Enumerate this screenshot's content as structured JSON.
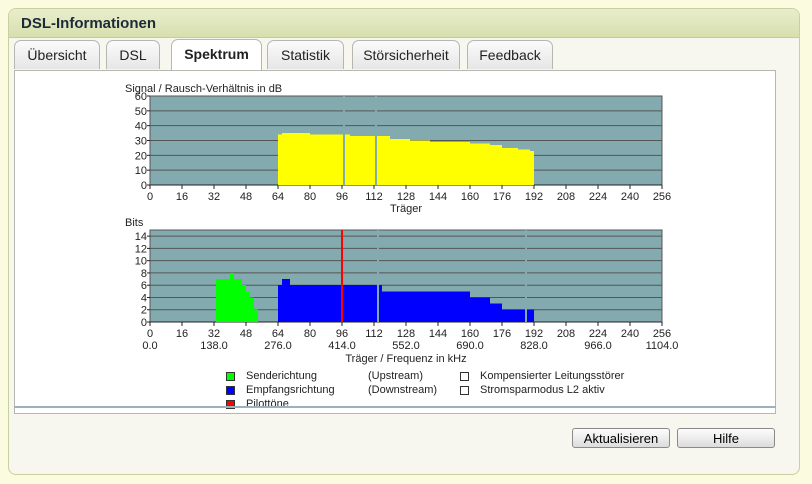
{
  "header": {
    "title": "DSL-Informationen"
  },
  "tabs": [
    {
      "label": "Übersicht"
    },
    {
      "label": "DSL"
    },
    {
      "label": "Spektrum",
      "active": true
    },
    {
      "label": "Statistik"
    },
    {
      "label": "Störsicherheit"
    },
    {
      "label": "Feedback"
    }
  ],
  "colors": {
    "plot_bg": "#83abaf",
    "snr": "#ffff00",
    "upstream": "#00ff00",
    "downstream": "#0000ff",
    "pilot": "#ff0000"
  },
  "chart_data": [
    {
      "type": "bar",
      "title": "Signal / Rausch-Verhältnis in dB",
      "xlabel": "Träger",
      "ylabel": "Signal / Rausch-Verhältnis in dB",
      "xlim": [
        0,
        256
      ],
      "ylim": [
        0,
        60
      ],
      "xticks": [
        "0",
        "16",
        "32",
        "48",
        "64",
        "80",
        "96",
        "112",
        "128",
        "144",
        "160",
        "176",
        "192",
        "208",
        "224",
        "240",
        "256"
      ],
      "yticks": [
        "0",
        "10",
        "20",
        "30",
        "40",
        "50",
        "60"
      ],
      "series": [
        {
          "name": "",
          "x": [
            64,
            66,
            70,
            80,
            90,
            96,
            100,
            112,
            120,
            130,
            140,
            150,
            160,
            170,
            176,
            184,
            190
          ],
          "values": [
            34,
            35,
            35,
            34,
            34,
            34,
            33,
            33,
            31,
            30,
            29,
            29,
            28,
            27,
            25,
            24,
            23
          ]
        }
      ]
    },
    {
      "type": "bar",
      "title": "Bits",
      "xlabel": "Träger / Frequenz in kHz",
      "ylabel": "Bits",
      "xlim": [
        0,
        256
      ],
      "ylim": [
        0,
        15
      ],
      "xticks": [
        "0",
        "16",
        "32",
        "48",
        "64",
        "80",
        "96",
        "112",
        "128",
        "144",
        "160",
        "176",
        "192",
        "208",
        "224",
        "240",
        "256"
      ],
      "freq_ticks": [
        "0.0",
        "138.0",
        "276.0",
        "414.0",
        "552.0",
        "690.0",
        "828.0",
        "966.0",
        "1104.0"
      ],
      "yticks": [
        "0",
        "2",
        "4",
        "6",
        "8",
        "10",
        "12",
        "14"
      ],
      "series": [
        {
          "name": "Senderichtung",
          "x": [
            33,
            36,
            38,
            40,
            42,
            44,
            46,
            48,
            50,
            52
          ],
          "values": [
            7,
            7,
            7,
            8,
            7,
            7,
            6,
            5,
            4,
            2
          ]
        },
        {
          "name": "Empfangsrichtung",
          "x": [
            64,
            66,
            70,
            80,
            96,
            112,
            116,
            128,
            140,
            150,
            160,
            170,
            176,
            184,
            190
          ],
          "values": [
            6,
            7,
            6,
            6,
            6,
            6,
            5,
            5,
            5,
            5,
            4,
            3,
            2,
            2,
            2
          ]
        },
        {
          "name": "Pilottöne",
          "x": [
            96
          ],
          "values": [
            15
          ]
        }
      ]
    }
  ],
  "legend": {
    "upstream": {
      "label": "Senderichtung",
      "direction": "(Upstream)"
    },
    "downstream": {
      "label": "Empfangsrichtung",
      "direction": "(Downstream)"
    },
    "pilot": {
      "label": "Pilottöne"
    },
    "compensated": {
      "label": "Kompensierter Leitungsstörer"
    },
    "powersave": {
      "label": "Stromsparmodus L2 aktiv"
    }
  },
  "buttons": {
    "refresh": "Aktualisieren",
    "help": "Hilfe"
  }
}
